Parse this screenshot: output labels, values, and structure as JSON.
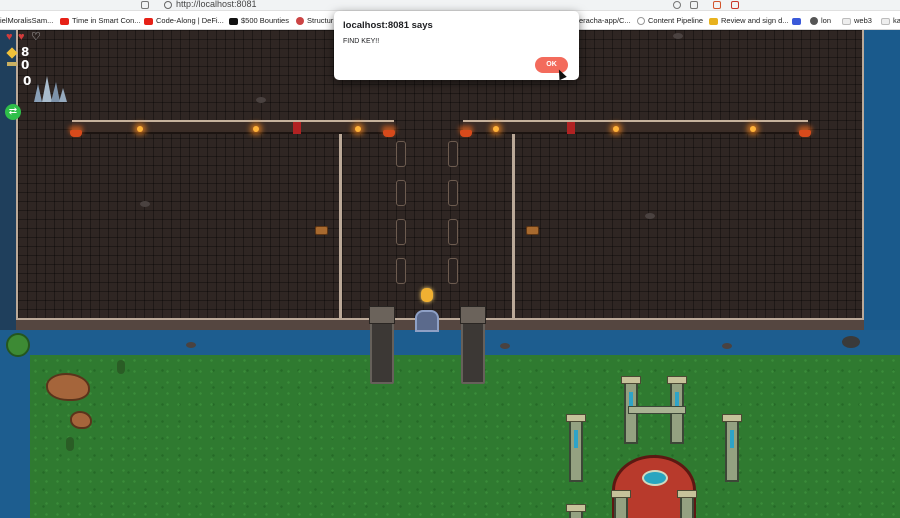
{
  "browser": {
    "url": "http://localhost:8081",
    "bookmarks": [
      {
        "label": "ielMoralisSam...",
        "icon": "globe-icon"
      },
      {
        "label": "Time in Smart Con...",
        "icon": "youtube-icon"
      },
      {
        "label": "Code-Along | DeFi...",
        "icon": "youtube-icon"
      },
      {
        "label": "$500 Bounties",
        "icon": "bounty-icon"
      },
      {
        "label": "Structur",
        "icon": "globe-icon"
      },
      {
        "label": "eracha-app/C...",
        "icon": "github-icon"
      },
      {
        "label": "Content Pipeline",
        "icon": "doc-icon"
      },
      {
        "label": "Review and sign d...",
        "icon": "download-icon"
      },
      {
        "label": "",
        "icon": "blue-square-icon"
      },
      {
        "label": "lon",
        "icon": "globe-icon"
      },
      {
        "label": "web3",
        "icon": "folder-icon"
      },
      {
        "label": "ka",
        "icon": "folder-icon"
      }
    ]
  },
  "dialog": {
    "title": "localhost:8081 says",
    "message": "FIND KEY!!",
    "ok_label": "OK",
    "ok_color": "#f36b5c"
  },
  "hud": {
    "hearts": 3,
    "hearts_full": 2,
    "coins": "8",
    "keys": "0",
    "items": "0"
  }
}
